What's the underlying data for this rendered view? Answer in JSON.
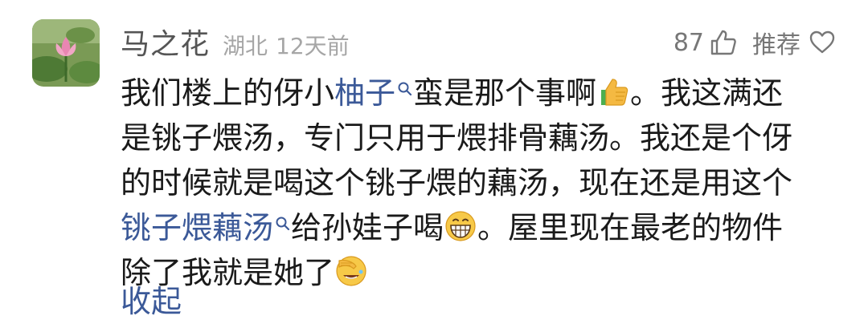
{
  "comment": {
    "username": "马之花",
    "location": "湖北",
    "time": "12天前",
    "like_count": "87",
    "recommend_label": "推荐",
    "collapse_label": "收起",
    "link_color": "#3b5998",
    "lines": [
      {
        "s1": "我们楼上的伢小",
        "link1": "柚子",
        "s2": "蛮是那个事啊",
        "s3": "。我这满还"
      },
      {
        "text": "是铫子煨汤，专门只用于煨排骨藕汤。我还是个伢"
      },
      {
        "text": "的时候就是喝这个铫子煨的藕汤，现在还是用这个"
      },
      {
        "link2": "铫子煨藕汤",
        "s4": "给孙娃子喝",
        "s5": "。屋里现在最老的物件"
      },
      {
        "s6": "除了我就是她了"
      }
    ],
    "icons": {
      "avatar": "lotus-flower-avatar",
      "like": "thumbs-up-outline-icon",
      "heart": "heart-outline-icon",
      "search": "search-icon",
      "emoji_thumbs": "thumbs-up-emoji",
      "emoji_grin": "grinning-emoji",
      "emoji_facepalm": "facepalm-laughing-emoji"
    }
  }
}
